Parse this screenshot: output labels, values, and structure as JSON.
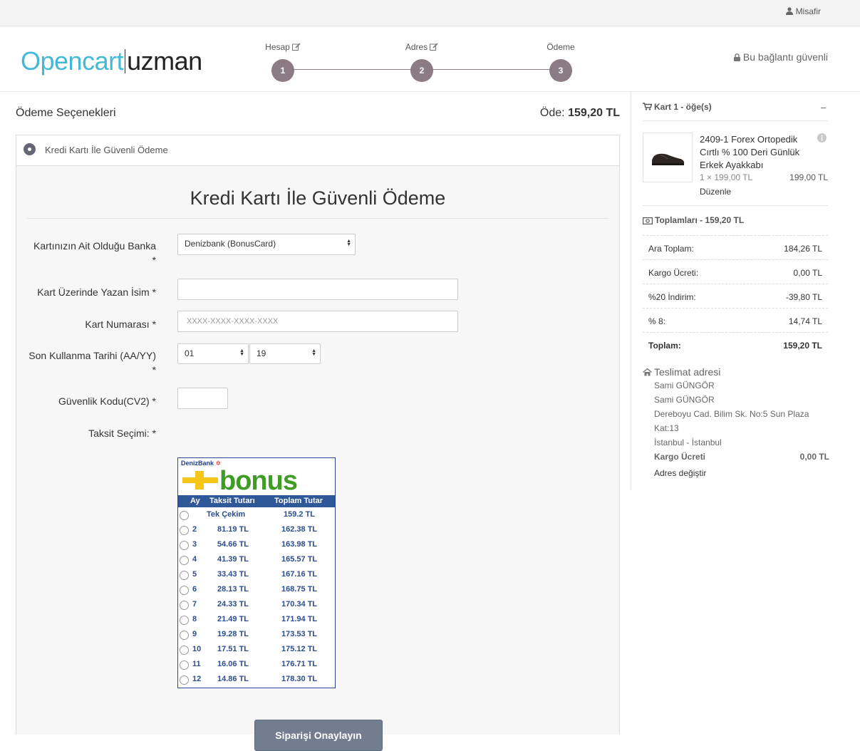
{
  "topbar": {
    "guest_label": "Misafir"
  },
  "header": {
    "logo_part1": "Opencart",
    "logo_part2": "uzman",
    "steps": [
      {
        "label": "Hesap",
        "number": "1"
      },
      {
        "label": "Adres",
        "number": "2"
      },
      {
        "label": "Ödeme",
        "number": "3"
      }
    ],
    "secure_label": "Bu bağlantı güvenli"
  },
  "main": {
    "options_title": "Ödeme Seçenekleri",
    "pay_prefix": "Öde:",
    "pay_amount": "159,20 TL",
    "method_label": "Kredi Kartı İle Güvenli Ödeme",
    "form_title": "Kredi Kartı İle Güvenli Ödeme",
    "fields": {
      "bank_label": "Kartınızın Ait Olduğu Banka",
      "bank_value": "Denizbank (BonusCard)",
      "name_label": "Kart Üzerinde Yazan İsim *",
      "name_value": "",
      "number_label": "Kart Numarası *",
      "number_placeholder": "XXXX-XXXX-XXXX-XXXX",
      "expiry_label": "Son Kullanma Tarihi (AA/YY)",
      "expiry_month": "01",
      "expiry_year": "19",
      "cvv_label": "Güvenlik Kodu(CV2) *",
      "installment_label": "Taksit Seçimi: *",
      "required_mark": "*"
    },
    "installment": {
      "brand": "DenizBank",
      "brand_mark": "✡",
      "logo_word": "bonus",
      "headers": [
        "Ay",
        "Taksit Tutarı",
        "Toplam Tutar"
      ],
      "single_label": "Tek Çekim",
      "single_total": "159.2 TL",
      "rows": [
        {
          "months": "2",
          "monthly": "81.19 TL",
          "total": "162.38 TL"
        },
        {
          "months": "3",
          "monthly": "54.66 TL",
          "total": "163.98 TL"
        },
        {
          "months": "4",
          "monthly": "41.39 TL",
          "total": "165.57 TL"
        },
        {
          "months": "5",
          "monthly": "33.43 TL",
          "total": "167.16 TL"
        },
        {
          "months": "6",
          "monthly": "28.13 TL",
          "total": "168.75 TL"
        },
        {
          "months": "7",
          "monthly": "24.33 TL",
          "total": "170.34 TL"
        },
        {
          "months": "8",
          "monthly": "21.49 TL",
          "total": "171.94 TL"
        },
        {
          "months": "9",
          "monthly": "19.28 TL",
          "total": "173.53 TL"
        },
        {
          "months": "10",
          "monthly": "17.51 TL",
          "total": "175.12 TL"
        },
        {
          "months": "11",
          "monthly": "16.06 TL",
          "total": "176.71 TL"
        },
        {
          "months": "12",
          "monthly": "14.86 TL",
          "total": "178.30 TL"
        }
      ]
    },
    "confirm_label": "Siparişi Onaylayın"
  },
  "sidebar": {
    "cart_title": "Kart 1 - öğe(s)",
    "collapse": "–",
    "product": {
      "name": "2409-1 Forex Ortopedik Cırtlı % 100 Deri Günlük Erkek Ayakkabı",
      "qty_price": "1 × 199,00 TL",
      "price": "199,00 TL",
      "edit": "Düzenle"
    },
    "totals_title": "Toplamları - 159,20 TL",
    "totals": [
      {
        "label": "Ara Toplam:",
        "value": "184,26 TL"
      },
      {
        "label": "Kargo Ücreti:",
        "value": "0,00 TL"
      },
      {
        "label": "%20 İndirim:",
        "value": "-39,80 TL"
      },
      {
        "label": "% 8:",
        "value": "14,74 TL"
      },
      {
        "label": "Toplam:",
        "value": "159,20 TL"
      }
    ],
    "shipping": {
      "title": "Teslimat adresi",
      "lines": [
        "Sami GÜNGÖR",
        "Sami GÜNGÖR",
        "Dereboyu Cad. Bilim Sk. No:5 Sun Plaza",
        "Kat:13",
        "İstanbul - İstanbul"
      ],
      "cost_label": "Kargo Ücreti",
      "cost_value": "0,00 TL",
      "change": "Adres değiştir"
    }
  },
  "colors": {
    "logo_accent": "#44b9d6",
    "step_circle": "#8b7b85",
    "button": "#727d8f",
    "installment_blue": "#2b4c8f",
    "bonus_green": "#3f9c25",
    "bonus_yellow": "#f5c518"
  }
}
